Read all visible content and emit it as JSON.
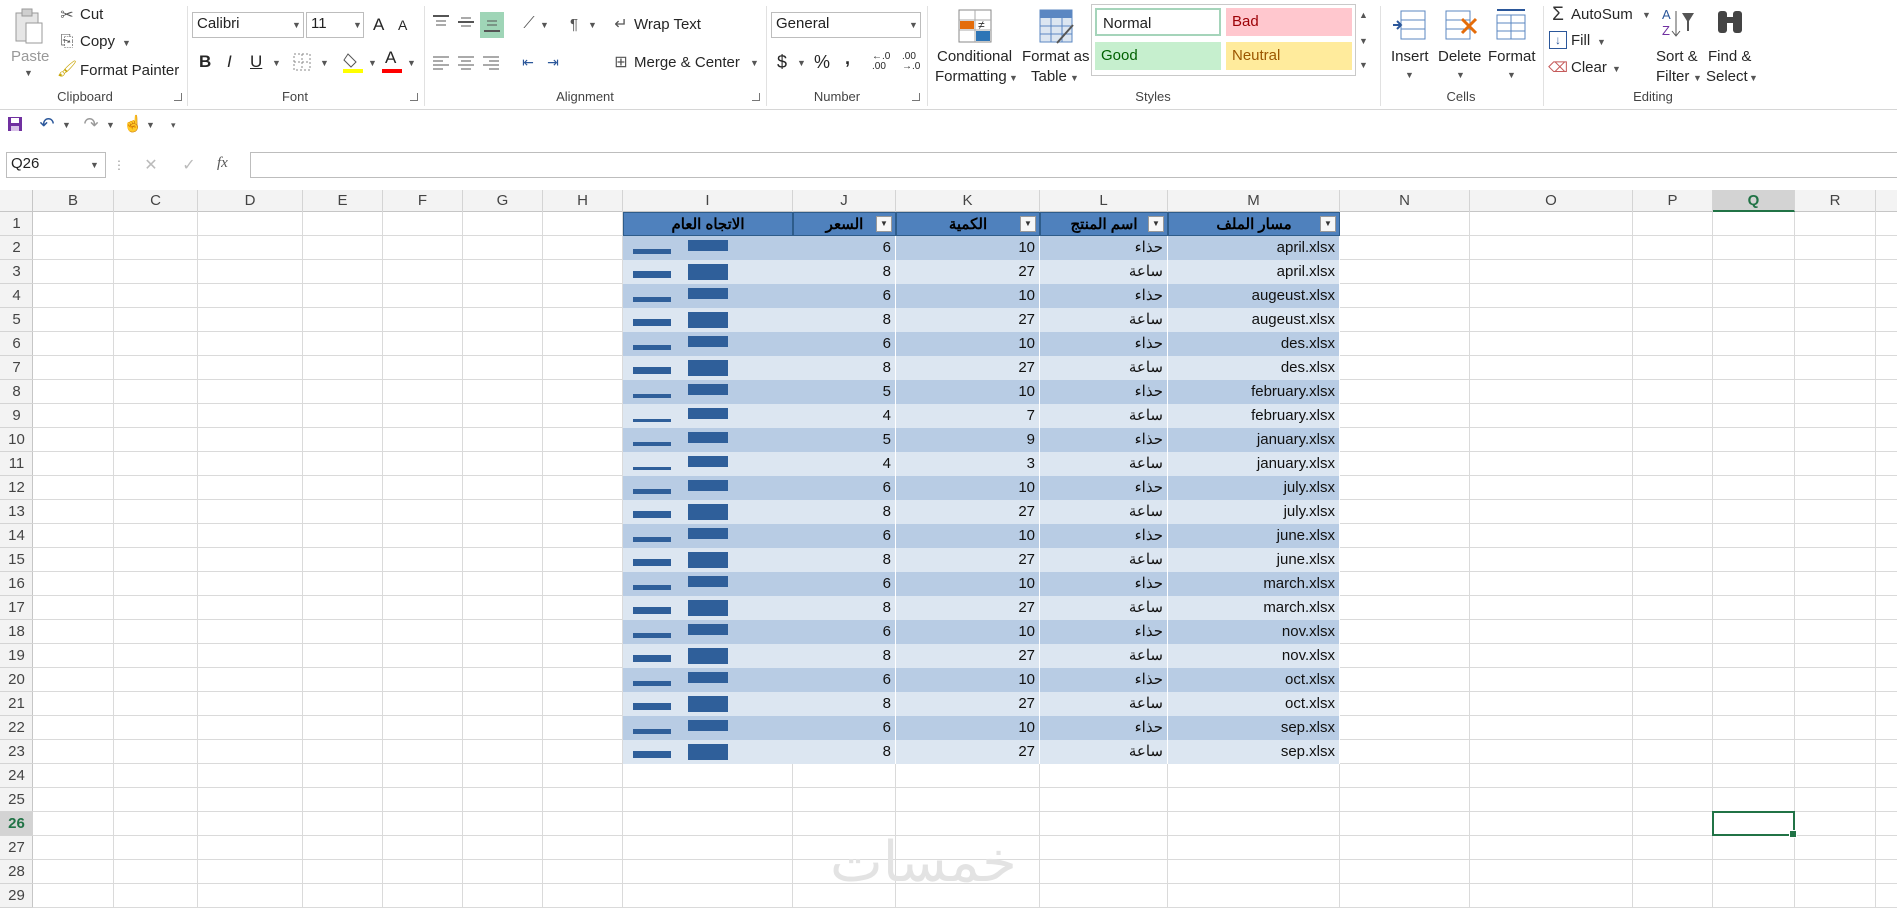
{
  "ribbon": {
    "clipboard": {
      "paste": "Paste",
      "cut": "Cut",
      "copy": "Copy",
      "format_painter": "Format Painter",
      "label": "Clipboard"
    },
    "font": {
      "name": "Calibri",
      "size": "11",
      "bold": "B",
      "italic": "I",
      "underline": "U",
      "grow": "A",
      "shrink": "A",
      "font_color_glyph": "A",
      "label": "Font"
    },
    "alignment": {
      "wrap_text": "Wrap Text",
      "merge_center": "Merge & Center",
      "label": "Alignment"
    },
    "number": {
      "format": "General",
      "currency": "$",
      "percent": "%",
      "comma": ",",
      "inc_decimal": "←.0 .00",
      "dec_decimal": ".00 →.0",
      "label": "Number"
    },
    "styles": {
      "conditional_formatting": "Conditional",
      "conditional_formatting_2": "Formatting",
      "format_as_table": "Format as",
      "format_as_table_2": "Table",
      "normal": "Normal",
      "bad": "Bad",
      "good": "Good",
      "neutral": "Neutral",
      "label": "Styles"
    },
    "cells": {
      "insert": "Insert",
      "delete": "Delete",
      "format": "Format",
      "label": "Cells"
    },
    "editing": {
      "autosum": "AutoSum",
      "fill": "Fill",
      "clear": "Clear",
      "sort_filter": "Sort &",
      "sort_filter_2": "Filter",
      "find_select": "Find &",
      "find_select_2": "Select",
      "label": "Editing"
    }
  },
  "formula_bar": {
    "name_box": "Q26",
    "fx": "fx",
    "formula": ""
  },
  "sheet": {
    "columns": [
      "B",
      "C",
      "D",
      "E",
      "F",
      "G",
      "H",
      "I",
      "J",
      "K",
      "L",
      "M",
      "N",
      "O",
      "P",
      "Q",
      "R"
    ],
    "selected_column": "Q",
    "rows": [
      "1",
      "2",
      "3",
      "4",
      "5",
      "6",
      "7",
      "8",
      "9",
      "10",
      "11",
      "12",
      "13",
      "14",
      "15",
      "16",
      "17",
      "18",
      "19",
      "20",
      "21",
      "22",
      "23",
      "24",
      "25",
      "26",
      "27",
      "28",
      "29"
    ],
    "selected_row": "26",
    "table": {
      "headers": {
        "I": "الاتجاه العام",
        "J": "السعر",
        "K": "الكمية",
        "L": "اسم المنتج",
        "M": "مسار الملف"
      },
      "rows": [
        {
          "J": "6",
          "K": "10",
          "L": "حذاء",
          "M": "april.xlsx"
        },
        {
          "J": "8",
          "K": "27",
          "L": "ساعة",
          "M": "april.xlsx"
        },
        {
          "J": "6",
          "K": "10",
          "L": "حذاء",
          "M": "augeust.xlsx"
        },
        {
          "J": "8",
          "K": "27",
          "L": "ساعة",
          "M": "augeust.xlsx"
        },
        {
          "J": "6",
          "K": "10",
          "L": "حذاء",
          "M": "des.xlsx"
        },
        {
          "J": "8",
          "K": "27",
          "L": "ساعة",
          "M": "des.xlsx"
        },
        {
          "J": "5",
          "K": "10",
          "L": "حذاء",
          "M": "february.xlsx"
        },
        {
          "J": "4",
          "K": "7",
          "L": "ساعة",
          "M": "february.xlsx"
        },
        {
          "J": "5",
          "K": "9",
          "L": "حذاء",
          "M": "january.xlsx"
        },
        {
          "J": "4",
          "K": "3",
          "L": "ساعة",
          "M": "january.xlsx"
        },
        {
          "J": "6",
          "K": "10",
          "L": "حذاء",
          "M": "july.xlsx"
        },
        {
          "J": "8",
          "K": "27",
          "L": "ساعة",
          "M": "july.xlsx"
        },
        {
          "J": "6",
          "K": "10",
          "L": "حذاء",
          "M": "june.xlsx"
        },
        {
          "J": "8",
          "K": "27",
          "L": "ساعة",
          "M": "june.xlsx"
        },
        {
          "J": "6",
          "K": "10",
          "L": "حذاء",
          "M": "march.xlsx"
        },
        {
          "J": "8",
          "K": "27",
          "L": "ساعة",
          "M": "march.xlsx"
        },
        {
          "J": "6",
          "K": "10",
          "L": "حذاء",
          "M": "nov.xlsx"
        },
        {
          "J": "8",
          "K": "27",
          "L": "ساعة",
          "M": "nov.xlsx"
        },
        {
          "J": "6",
          "K": "10",
          "L": "حذاء",
          "M": "oct.xlsx"
        },
        {
          "J": "8",
          "K": "27",
          "L": "ساعة",
          "M": "oct.xlsx"
        },
        {
          "J": "6",
          "K": "10",
          "L": "حذاء",
          "M": "sep.xlsx"
        },
        {
          "J": "8",
          "K": "27",
          "L": "ساعة",
          "M": "sep.xlsx"
        }
      ]
    }
  },
  "watermark": "خمسات",
  "colors": {
    "table_header": "#4f81bd",
    "band_dark": "#b8cce4",
    "band_light": "#dce6f1",
    "sparkline": "#2f5f9a",
    "selection": "#217346",
    "style_bad_bg": "#ffc7ce",
    "style_good_bg": "#c6efce",
    "style_neutral_bg": "#ffeb9c"
  }
}
